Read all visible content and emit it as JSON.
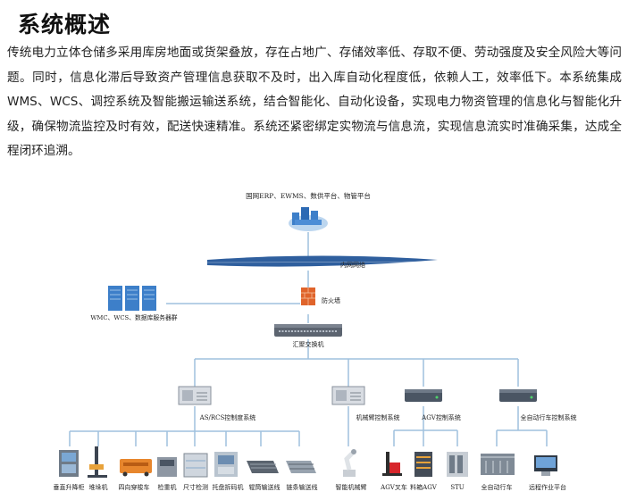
{
  "heading": "系统概述",
  "intro_lines": [
    "传统电力立体仓储多采用库房地面或货架叠放，存在占地广、存储效率低、存取不便、劳动强度及安全风",
    "险大等问题。同时，信息化滞后导致资产管理信息获取不及时，出入库自动化程度低，依赖人工，效率低",
    "下。本系统集成WMS、WCS、调控系统及智能搬运输送系统，结合智能化、自动化设备，实现电力物资",
    "管理的信息化与智能化升级，确保物流监控及时有效，配送快速精准。系统还紧密绑定实物流与信息流，",
    "实现信息流实时准确采集，达成全程闭环追溯。"
  ],
  "diagram": {
    "cloud_label": "国网ERP、EWMS、数供平台、物管平台",
    "intranet_label": "内网网络",
    "firewall_label": "防火墙",
    "servers_label": "WMC、WCS、数据库服务器群",
    "switch_label": "汇聚交换机",
    "controllers": {
      "ascs": "AS/RCS控制度系统",
      "arm": "机械臂控制系统",
      "agv": "AGV控制系统",
      "auto": "全自动行车控制系统"
    },
    "devices": [
      "垂直升降柜",
      "堆垛机",
      "四向穿梭车",
      "检重机",
      "尺寸检测",
      "托盘拆码机",
      "辊筒输送线",
      "链条输送线",
      "智能机械臂",
      "AGV叉车",
      "料箱AGV",
      "STU",
      "全自动行车",
      "远程作业平台"
    ],
    "colors": {
      "line": "#9fc1de",
      "network": "#2f5f9e",
      "server": "#3d7fc9"
    }
  }
}
